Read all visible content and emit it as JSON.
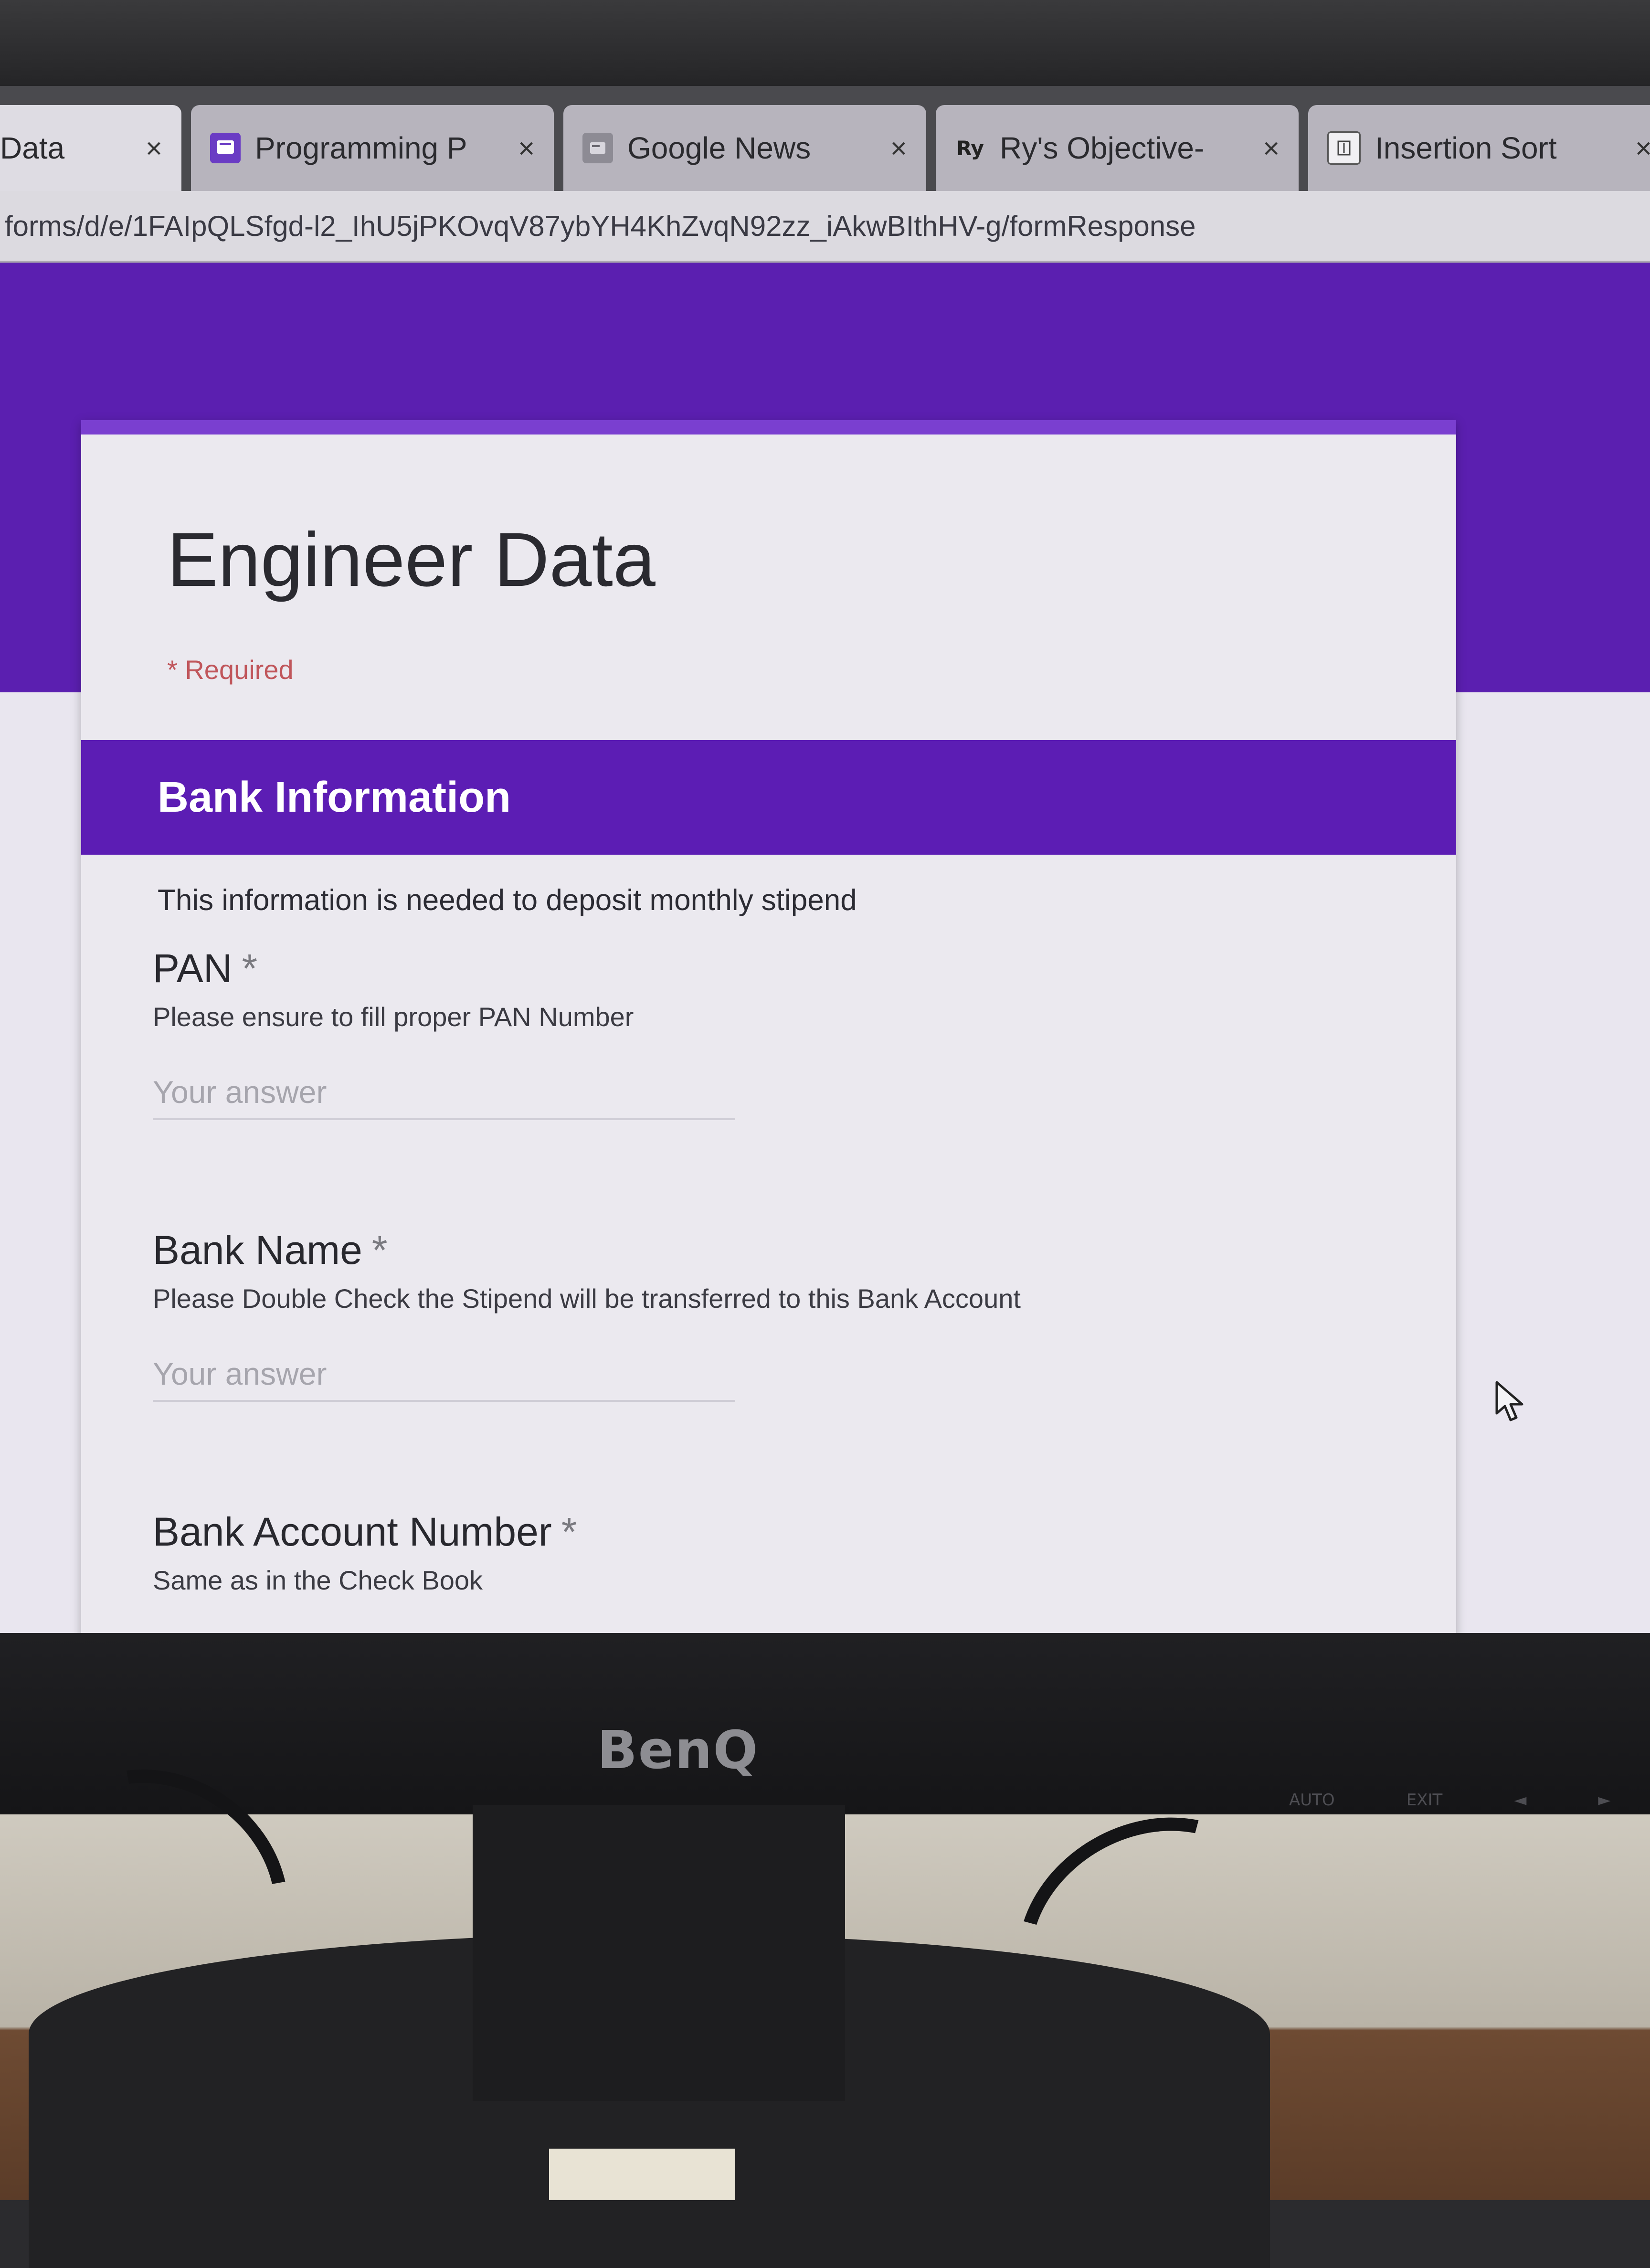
{
  "browser": {
    "tabs": [
      {
        "title": "Data",
        "favicon": "forms-icon",
        "active": true
      },
      {
        "title": "Programming P",
        "favicon": "programming-favicon-icon",
        "active": false
      },
      {
        "title": "Google News",
        "favicon": "google-news-icon",
        "active": false
      },
      {
        "title": "Ry's Objective-",
        "favicon": "ry-favicon-icon",
        "favicon_text": "Ry",
        "active": false
      },
      {
        "title": "Insertion Sort",
        "favicon": "document-favicon-icon",
        "active": false
      }
    ],
    "tab_close": "×",
    "url": "forms/d/e/1FAIpQLSfgd-l2_IhU5jPKOvqV87ybYH4KhZvqN92zz_iAkwBIthHV-g/formResponse"
  },
  "form": {
    "title": "Engineer Data",
    "required_note": "* Required",
    "section": {
      "title": "Bank Information",
      "description": "This information is needed to deposit monthly stipend"
    },
    "questions": [
      {
        "label": "PAN",
        "required_mark": "*",
        "help": "Please ensure to fill proper PAN Number",
        "placeholder": "Your answer"
      },
      {
        "label": "Bank Name",
        "required_mark": "*",
        "help": "Please Double Check the Stipend will be transferred to this Bank Account",
        "placeholder": "Your answer"
      },
      {
        "label": "Bank Account Number",
        "required_mark": "*",
        "help": "Same as in the Check Book"
      }
    ]
  },
  "monitor": {
    "brand": "BenQ",
    "osd_buttons": [
      "AUTO",
      "EXIT",
      "◄",
      "►"
    ]
  },
  "colors": {
    "form_purple": "#5c1db4",
    "header_band": "#5b1fb0",
    "required_red": "#c0565b"
  }
}
